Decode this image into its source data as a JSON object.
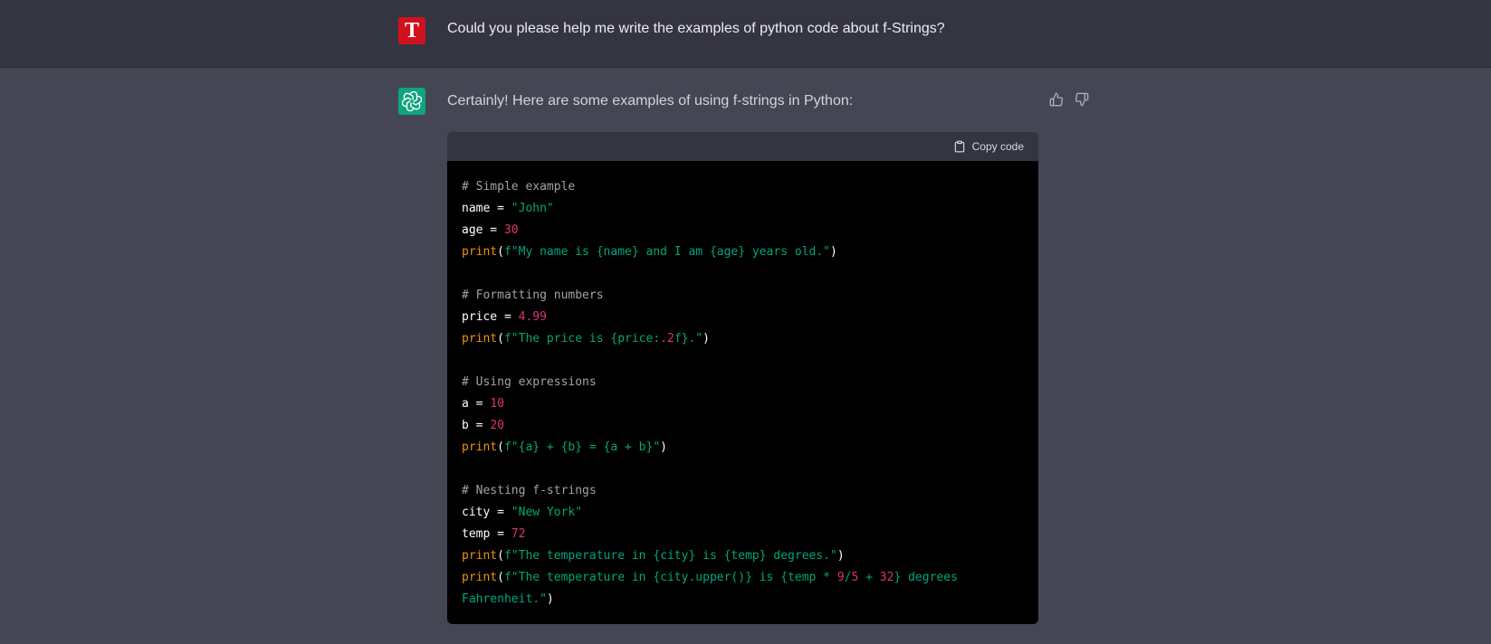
{
  "user_message": {
    "avatar_letter": "T",
    "text": "Could you please help me write the examples of python code about f-Strings?"
  },
  "assistant_message": {
    "intro": "Certainly! Here are some examples of using f-strings in Python:",
    "copy_label": "Copy code",
    "code_lines": [
      [
        {
          "t": "comment",
          "v": "# Simple example"
        }
      ],
      [
        {
          "t": "var",
          "v": "name"
        },
        {
          "t": "op",
          "v": " = "
        },
        {
          "t": "str",
          "v": "\"John\""
        }
      ],
      [
        {
          "t": "var",
          "v": "age"
        },
        {
          "t": "op",
          "v": " = "
        },
        {
          "t": "num",
          "v": "30"
        }
      ],
      [
        {
          "t": "fn",
          "v": "print"
        },
        {
          "t": "punc",
          "v": "("
        },
        {
          "t": "str",
          "v": "f\"My name is {name} and I am {age} years old.\""
        },
        {
          "t": "punc",
          "v": ")"
        }
      ],
      [],
      [
        {
          "t": "comment",
          "v": "# Formatting numbers"
        }
      ],
      [
        {
          "t": "var",
          "v": "price"
        },
        {
          "t": "op",
          "v": " = "
        },
        {
          "t": "num",
          "v": "4.99"
        }
      ],
      [
        {
          "t": "fn",
          "v": "print"
        },
        {
          "t": "punc",
          "v": "("
        },
        {
          "t": "str",
          "v": "f\"The price is {price:"
        },
        {
          "t": "num",
          "v": ".2"
        },
        {
          "t": "str",
          "v": "f}.\""
        },
        {
          "t": "punc",
          "v": ")"
        }
      ],
      [],
      [
        {
          "t": "comment",
          "v": "# Using expressions"
        }
      ],
      [
        {
          "t": "var",
          "v": "a"
        },
        {
          "t": "op",
          "v": " = "
        },
        {
          "t": "num",
          "v": "10"
        }
      ],
      [
        {
          "t": "var",
          "v": "b"
        },
        {
          "t": "op",
          "v": " = "
        },
        {
          "t": "num",
          "v": "20"
        }
      ],
      [
        {
          "t": "fn",
          "v": "print"
        },
        {
          "t": "punc",
          "v": "("
        },
        {
          "t": "str",
          "v": "f\"{a} + {b} = {a + b}\""
        },
        {
          "t": "punc",
          "v": ")"
        }
      ],
      [],
      [
        {
          "t": "comment",
          "v": "# Nesting f-strings"
        }
      ],
      [
        {
          "t": "var",
          "v": "city"
        },
        {
          "t": "op",
          "v": " = "
        },
        {
          "t": "str",
          "v": "\"New York\""
        }
      ],
      [
        {
          "t": "var",
          "v": "temp"
        },
        {
          "t": "op",
          "v": " = "
        },
        {
          "t": "num",
          "v": "72"
        }
      ],
      [
        {
          "t": "fn",
          "v": "print"
        },
        {
          "t": "punc",
          "v": "("
        },
        {
          "t": "str",
          "v": "f\"The temperature in {city} is {temp} degrees.\""
        },
        {
          "t": "punc",
          "v": ")"
        }
      ],
      [
        {
          "t": "fn",
          "v": "print"
        },
        {
          "t": "punc",
          "v": "("
        },
        {
          "t": "str",
          "v": "f\"The temperature in {city.upper()} is {temp * "
        },
        {
          "t": "num",
          "v": "9"
        },
        {
          "t": "str",
          "v": "/"
        },
        {
          "t": "num",
          "v": "5"
        },
        {
          "t": "str",
          "v": " + "
        },
        {
          "t": "num",
          "v": "32"
        },
        {
          "t": "str",
          "v": "} degrees"
        }
      ],
      [
        {
          "t": "str",
          "v": "Fahrenheit.\""
        },
        {
          "t": "punc",
          "v": ")"
        }
      ]
    ]
  },
  "colors": {
    "user_band": "#343541",
    "assistant_band": "#444654",
    "user_avatar": "#d0111d",
    "bot_avatar": "#10a37f",
    "code_background": "#000000",
    "code_header": "#343541",
    "comment": "#a3a3a3",
    "string": "#00a67d",
    "number": "#df3079",
    "builtin": "#e9950c"
  },
  "icons": {
    "bot_avatar": "openai-logo-icon",
    "thumbs_up": "thumbs-up-icon",
    "thumbs_down": "thumbs-down-icon",
    "copy": "clipboard-icon"
  }
}
